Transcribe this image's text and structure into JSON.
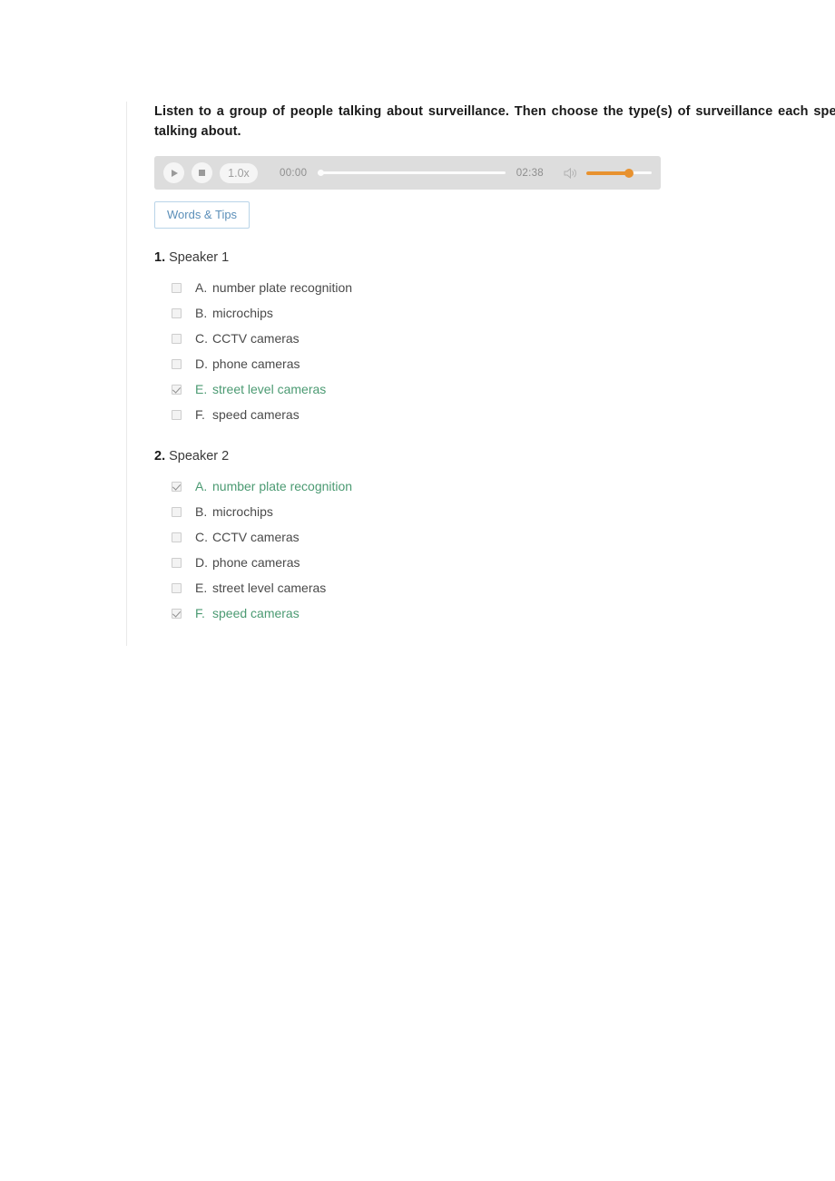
{
  "prompt": "Listen to a group of people talking about surveillance. Then choose the type(s) of surveillance each speaker is talking about.",
  "player": {
    "play_label": "play-icon",
    "stop_label": "stop-icon",
    "speed": "1.0x",
    "current_time": "00:00",
    "total_time": "02:38",
    "volume_icon": "speaker-icon",
    "volume_percent": 65,
    "progress_percent": 0,
    "accent_color": "#e8922f",
    "background_color": "#dddddd"
  },
  "words_tips_label": "Words & Tips",
  "colors": {
    "selected_text": "#4b9a72",
    "link_blue": "#5b8fb9",
    "body_text": "#4a4a4a"
  },
  "questions": [
    {
      "number": "1.",
      "title": "Speaker 1",
      "options": [
        {
          "letter": "A.",
          "text": "number plate recognition",
          "checked": false
        },
        {
          "letter": "B.",
          "text": "microchips",
          "checked": false
        },
        {
          "letter": "C.",
          "text": "CCTV cameras",
          "checked": false
        },
        {
          "letter": "D.",
          "text": "phone cameras",
          "checked": false
        },
        {
          "letter": "E.",
          "text": "street level cameras",
          "checked": true
        },
        {
          "letter": "F.",
          "text": "speed cameras",
          "checked": false
        }
      ]
    },
    {
      "number": "2.",
      "title": "Speaker 2",
      "options": [
        {
          "letter": "A.",
          "text": "number plate recognition",
          "checked": true
        },
        {
          "letter": "B.",
          "text": "microchips",
          "checked": false
        },
        {
          "letter": "C.",
          "text": "CCTV cameras",
          "checked": false
        },
        {
          "letter": "D.",
          "text": "phone cameras",
          "checked": false
        },
        {
          "letter": "E.",
          "text": "street level cameras",
          "checked": false
        },
        {
          "letter": "F.",
          "text": "speed cameras",
          "checked": true
        }
      ]
    }
  ]
}
